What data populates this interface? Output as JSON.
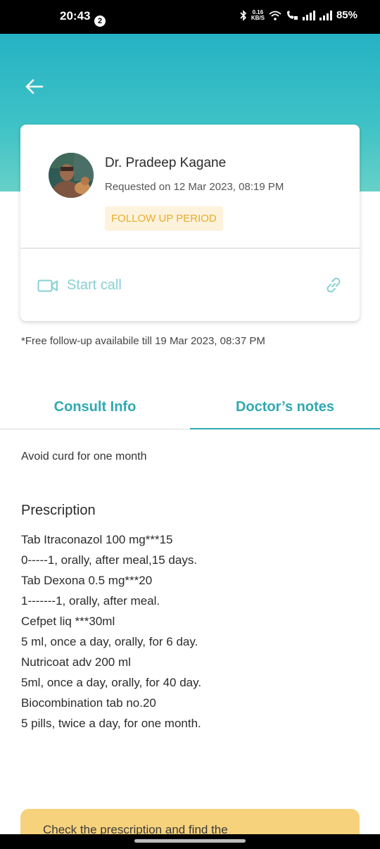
{
  "status_bar": {
    "time": "20:43",
    "notification_count": "2",
    "speed_value": "0.16",
    "speed_unit": "KB/S",
    "battery": "85%"
  },
  "doctor": {
    "name": "Dr. Pradeep Kagane",
    "requested": "Requested on 12 Mar 2023, 08:19 PM",
    "period_badge": "FOLLOW UP PERIOD"
  },
  "call": {
    "label": "Start call"
  },
  "free_followup": "*Free follow-up availabile till 19 Mar 2023, 08:37 PM",
  "tabs": [
    {
      "label": "Consult Info"
    },
    {
      "label": "Doctor’s notes"
    }
  ],
  "notes": {
    "text": "Avoid curd for one month",
    "prescription_title": "Prescription",
    "prescription_lines": [
      "Tab Itraconazol 100 mg***15",
      "0-----1, orally, after meal,15 days.",
      "Tab Dexona 0.5 mg***20",
      "1-------1, orally, after meal.",
      "Cefpet liq ***30ml",
      "5 ml, once a day, orally, for 6 day.",
      "Nutricoat adv 200 ml",
      "5ml, once a day, orally, for 40 day.",
      "Biocombination tab no.20",
      "5 pills, twice a day, for one month."
    ]
  },
  "cta": {
    "text": "Check the prescription and find the"
  },
  "colors": {
    "accent": "#2fa9b1",
    "header_top": "#26b2c4",
    "header_bottom": "#67d1c8",
    "badge_bg": "#fdf2dc",
    "badge_text": "#e7ad2c",
    "cta_bg": "#f7d27c"
  },
  "icons": {
    "back": "arrow-left-icon",
    "video": "video-camera-icon",
    "link": "link-icon"
  }
}
